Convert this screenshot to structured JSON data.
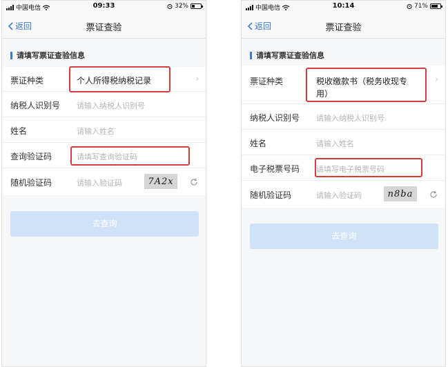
{
  "left": {
    "status": {
      "carrier": "中国电信",
      "time": "09:33",
      "battery": "32%",
      "battery_level": 0.32
    },
    "nav": {
      "back_label": "返回",
      "title": "票证查验"
    },
    "section_title": "请填写票证查验信息",
    "rows": [
      {
        "label": "票证种类",
        "value": "个人所得税纳税记录"
      },
      {
        "label": "纳税人识别号",
        "placeholder": "请输入纳税人识别号"
      },
      {
        "label": "姓名",
        "placeholder": "请输入姓名"
      },
      {
        "label": "查询验证码",
        "placeholder": "请填写查询验证码"
      },
      {
        "label": "随机验证码",
        "placeholder": "请输入验证码",
        "captcha": "7A2x"
      }
    ],
    "submit_label": "去查询"
  },
  "right": {
    "status": {
      "carrier": "中国电信",
      "time": "10:14",
      "battery": "71%",
      "battery_level": 0.71
    },
    "nav": {
      "back_label": "返回",
      "title": "票证查验"
    },
    "section_title": "请填写票证查验信息",
    "rows": [
      {
        "label": "票证种类",
        "value_line1": "税收缴款书（税务收现专",
        "value_line2": "用）"
      },
      {
        "label": "纳税人识别号",
        "placeholder": "请输入纳税人识别号"
      },
      {
        "label": "姓名",
        "placeholder": "请输入姓名"
      },
      {
        "label": "电子税票号码",
        "placeholder": "请填写电子税票号码"
      },
      {
        "label": "随机验证码",
        "placeholder": "请输入验证码",
        "captcha": "n8ba"
      }
    ],
    "submit_label": "去查询"
  },
  "colors": {
    "accent": "#3a7bd5",
    "highlight": "#d63a3a",
    "button_disabled": "#cfe2f8"
  }
}
